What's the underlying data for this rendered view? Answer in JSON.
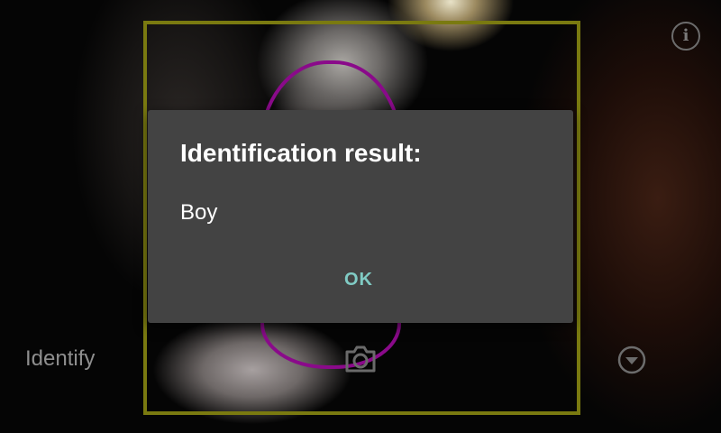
{
  "colors": {
    "frame": "#7a7a10",
    "oval": "#8a0a8a",
    "dialog_bg": "#434343",
    "ok_accent": "#80cbc4"
  },
  "icons": {
    "info": "info-icon",
    "camera": "camera-icon",
    "dropdown": "chevron-down-circle-icon"
  },
  "toolbar": {
    "info_glyph": "i",
    "identify_label": "Identify"
  },
  "dialog": {
    "title": "Identification result:",
    "message": "Boy",
    "ok_label": "OK"
  }
}
